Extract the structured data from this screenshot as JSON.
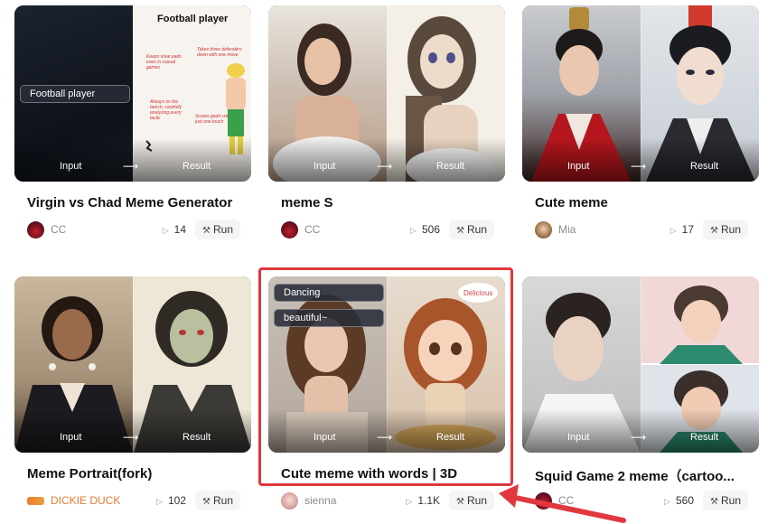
{
  "labels": {
    "input": "Input",
    "result": "Result",
    "run": "Run"
  },
  "cards": [
    {
      "title": "Virgin vs Chad Meme Generator",
      "author": "CC",
      "views": "14",
      "tags": [
        "Football player"
      ],
      "overlay_heading": "Football player",
      "avatar_icon": "mask-avatar-icon"
    },
    {
      "title": "meme S",
      "author": "CC",
      "views": "506",
      "tags": [],
      "avatar_icon": "mask-avatar-icon"
    },
    {
      "title": "Cute meme",
      "author": "Mia",
      "views": "17",
      "tags": [],
      "avatar_icon": "girl-avatar-icon"
    },
    {
      "title": "Meme Portrait(fork)",
      "author": "DICKIE DUCK",
      "views": "102",
      "tags": [],
      "avatar_icon": "duck-logo-icon"
    },
    {
      "title": "Cute meme with words | 3D",
      "author": "sienna",
      "views": "1.1K",
      "tags": [
        "Dancing",
        "beautiful~"
      ],
      "bubble": "Delicious",
      "avatar_icon": "girl-avatar-icon"
    },
    {
      "title": "Squid Game 2 meme（cartoo...",
      "author": "CC",
      "views": "560",
      "tags": [],
      "avatar_icon": "mask-avatar-icon"
    }
  ],
  "highlight": {
    "color": "#e0383e",
    "target_card": 4
  }
}
